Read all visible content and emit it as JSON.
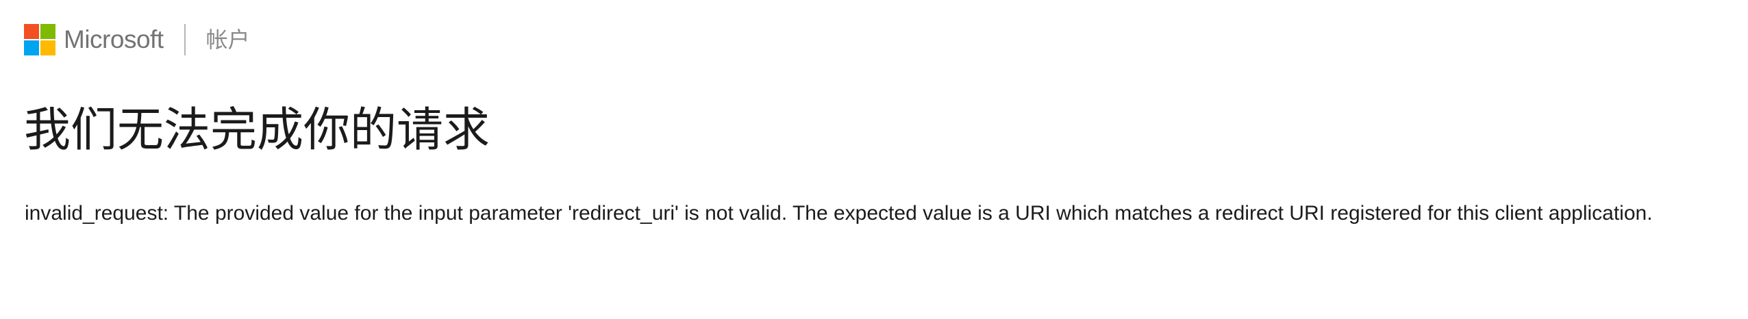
{
  "header": {
    "brand": "Microsoft",
    "section": "帐户",
    "logo_colors": [
      "#f25022",
      "#7fba00",
      "#00a4ef",
      "#ffb900"
    ]
  },
  "main": {
    "title": "我们无法完成你的请求",
    "error_message": "invalid_request: The provided value for the input parameter 'redirect_uri' is not valid. The expected value is a URI which matches a redirect URI registered for this client application."
  }
}
